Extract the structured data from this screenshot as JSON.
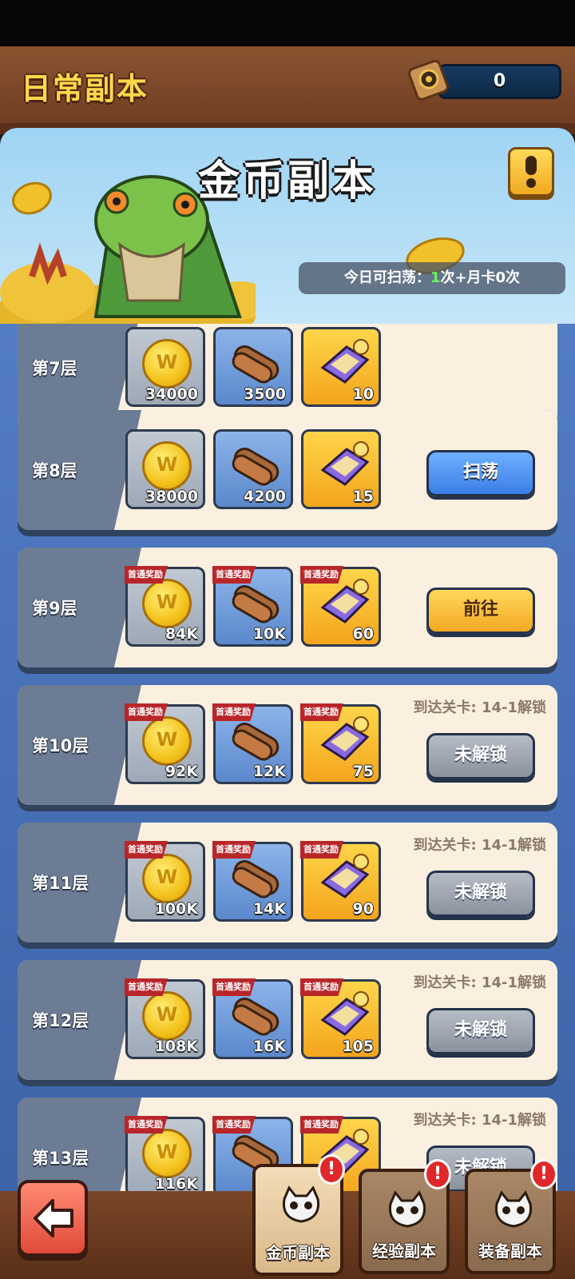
{
  "header": {
    "title": "日常副本",
    "counter_value": "0"
  },
  "banner": {
    "title": "金币副本",
    "sweep_label": "今日可扫荡：",
    "sweep_count": "1",
    "sweep_suffix": "次+月卡0次"
  },
  "first_clear_label": "首通奖励",
  "unlock_requirement": "到达关卡: 14-1解锁",
  "floors": [
    {
      "label": "第7层",
      "gold": "34000",
      "wood": "3500",
      "gem": "10",
      "first": false,
      "button": null
    },
    {
      "label": "第8层",
      "gold": "38000",
      "wood": "4200",
      "gem": "15",
      "first": false,
      "button": "扫荡",
      "button_style": "blue"
    },
    {
      "label": "第9层",
      "gold": "84K",
      "wood": "10K",
      "gem": "60",
      "first": true,
      "button": "前往",
      "button_style": "yellow"
    },
    {
      "label": "第10层",
      "gold": "92K",
      "wood": "12K",
      "gem": "75",
      "first": true,
      "button": "未解锁",
      "button_style": "gray",
      "locked": true
    },
    {
      "label": "第11层",
      "gold": "100K",
      "wood": "14K",
      "gem": "90",
      "first": true,
      "button": "未解锁",
      "button_style": "gray",
      "locked": true
    },
    {
      "label": "第12层",
      "gold": "108K",
      "wood": "16K",
      "gem": "105",
      "first": true,
      "button": "未解锁",
      "button_style": "gray",
      "locked": true
    },
    {
      "label": "第13层",
      "gold": "116K",
      "wood": "",
      "gem": "",
      "first": true,
      "button": "未解锁",
      "button_style": "gray",
      "locked": true
    }
  ],
  "bottom_tabs": [
    {
      "label": "金币副本",
      "active": true,
      "alert": "!"
    },
    {
      "label": "经验副本",
      "active": false,
      "alert": "!"
    },
    {
      "label": "装备副本",
      "active": false,
      "alert": "!"
    }
  ],
  "colors": {
    "gold_text": "#ffd84a",
    "panel_blue": "#4c75bd",
    "alert_red": "#e0282a"
  }
}
